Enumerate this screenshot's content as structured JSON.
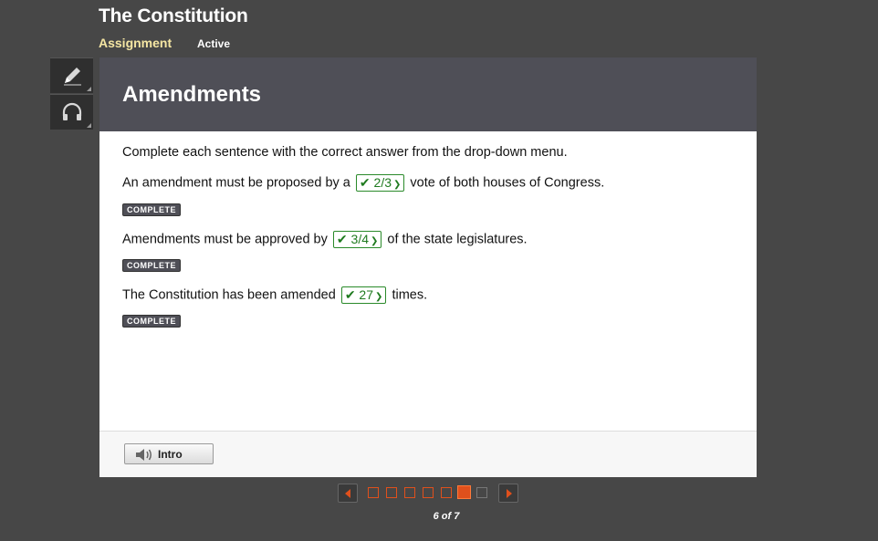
{
  "header": {
    "title": "The Constitution",
    "tab_assignment": "Assignment",
    "tab_active": "Active"
  },
  "tools": [
    {
      "icon": "pencil-icon"
    },
    {
      "icon": "headphones-icon"
    }
  ],
  "panel": {
    "title": "Amendments",
    "instructions": "Complete each sentence with the correct answer from the drop-down menu.",
    "questions": [
      {
        "before": "An amendment must be proposed by a",
        "answer": "✔ 2/3",
        "after": "vote of both houses of Congress.",
        "status": "COMPLETE"
      },
      {
        "before": "Amendments must be approved by",
        "answer": "✔ 3/4",
        "after": "of the state legislatures.",
        "status": "COMPLETE"
      },
      {
        "before": "The Constitution has been amended",
        "answer": "✔ 27",
        "after": "times.",
        "status": "COMPLETE"
      }
    ],
    "intro_button": "Intro"
  },
  "pager": {
    "label": "6 of 7",
    "current": 6,
    "total": 7
  },
  "colors": {
    "accent": "#e0501c",
    "correct": "#1f7a1f",
    "header_bg": "#4f4f57"
  }
}
